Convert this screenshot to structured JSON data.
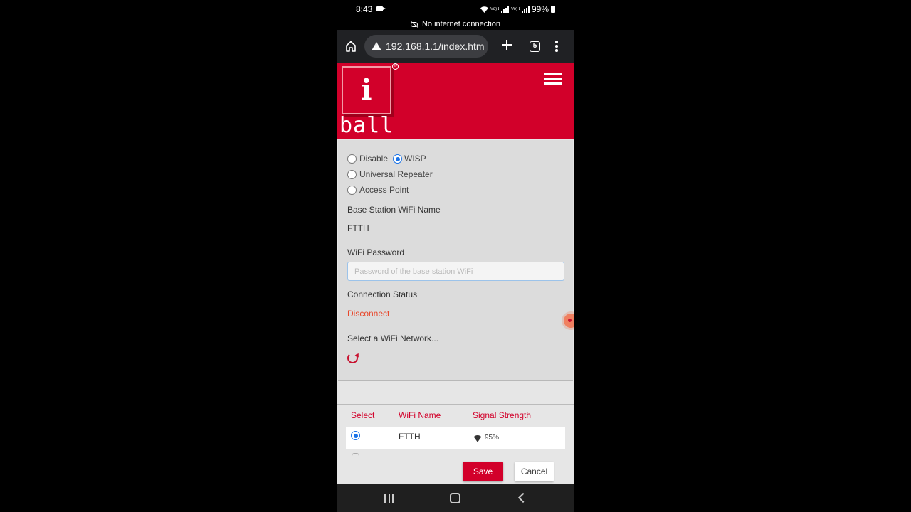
{
  "status_bar": {
    "time": "8:43",
    "battery": "99%",
    "network_label_1": "Vo) LTE1",
    "network_label_2": "Vo) LTE2"
  },
  "net_banner": "No internet connection",
  "browser": {
    "url": "192.168.1.1/index.htm",
    "tab_count": "5"
  },
  "brand": {
    "logo_letter": "i",
    "logo_word": "ball",
    "logo_mark": "®",
    "color": "#d2002a"
  },
  "mode": {
    "options": [
      {
        "label": "Disable",
        "selected": false
      },
      {
        "label": "WISP",
        "selected": true
      },
      {
        "label": "Universal Repeater",
        "selected": false
      },
      {
        "label": "Access Point",
        "selected": false
      }
    ]
  },
  "form": {
    "base_station_label": "Base Station WiFi Name",
    "base_station_value": "FTTH",
    "password_label": "WiFi Password",
    "password_placeholder": "Password of the base station WiFi",
    "connection_status_label": "Connection Status",
    "connection_status_value": "Disconnect",
    "select_network_label": "Select a WiFi Network..."
  },
  "wifi_table": {
    "headers": [
      "Select",
      "WiFi Name",
      "Signal Strength"
    ],
    "rows": [
      {
        "selected": true,
        "name": "FTTH",
        "signal": "95%"
      }
    ]
  },
  "buttons": {
    "save": "Save",
    "cancel": "Cancel"
  },
  "icons": {
    "home": "home-icon",
    "warning": "warning-icon",
    "new_tab": "plus-icon",
    "menu": "menu-dots-icon",
    "hamburger": "hamburger-icon",
    "refresh": "refresh-icon",
    "wifi": "wifi-signal-icon",
    "recents": "recents-icon",
    "home_nav": "home-nav-icon",
    "back": "back-icon"
  }
}
